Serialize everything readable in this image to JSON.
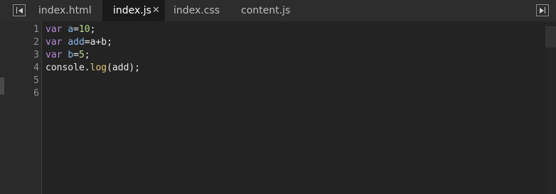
{
  "tabs": [
    {
      "label": "index.html",
      "active": false
    },
    {
      "label": "index.js",
      "active": true,
      "close": "✕"
    },
    {
      "label": "index.css",
      "active": false
    },
    {
      "label": "content.js",
      "active": false
    }
  ],
  "editor": {
    "line_numbers": [
      "1",
      "2",
      "3",
      "4",
      "5",
      "6"
    ],
    "lines": [
      {
        "kw": "var",
        "sp": " ",
        "id": "a",
        "op": "=",
        "num": "10",
        "end": ";"
      },
      {
        "kw": "var",
        "sp": " ",
        "id": "add",
        "op": "=",
        "expr": "a+b",
        "end": ";"
      },
      {
        "kw": "var",
        "sp": " ",
        "id": "b",
        "op": "=",
        "num": "5",
        "end": ";"
      },
      {
        "obj": "console.",
        "fn": "log",
        "args": "(add);"
      }
    ]
  },
  "colors": {
    "keyword": "#b48ad9",
    "identifier": "#8ab6ea",
    "number": "#b9d98a",
    "function": "#e3c57a",
    "background": "#232323"
  }
}
